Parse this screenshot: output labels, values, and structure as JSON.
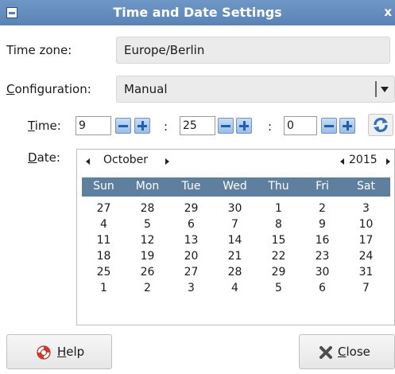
{
  "window": {
    "title": "Time and Date Settings",
    "close_glyph": "x",
    "colors": {
      "titlebar": "#5a83b5",
      "accent": "#5f7f9f",
      "spin_icon": "#1f5fb5"
    }
  },
  "timezone": {
    "label": "Time zone:",
    "value": "Europe/Berlin"
  },
  "configuration": {
    "label_first": "C",
    "label_rest": "onfiguration:",
    "value": "Manual",
    "icon": "chevron-down-icon"
  },
  "time": {
    "label_first": "T",
    "label_rest": "ime:",
    "hour": "9",
    "minute": "25",
    "second": "0",
    "separator": ":",
    "refresh_icon": "refresh-icon"
  },
  "date": {
    "label_first": "D",
    "label_rest": "ate:",
    "month": "October",
    "year": "2015",
    "weekdays": [
      "Sun",
      "Mon",
      "Tue",
      "Wed",
      "Thu",
      "Fri",
      "Sat"
    ],
    "weeks": [
      [
        "27",
        "28",
        "29",
        "30",
        "1",
        "2",
        "3"
      ],
      [
        "4",
        "5",
        "6",
        "7",
        "8",
        "9",
        "10"
      ],
      [
        "11",
        "12",
        "13",
        "14",
        "15",
        "16",
        "17"
      ],
      [
        "18",
        "19",
        "20",
        "21",
        "22",
        "23",
        "24"
      ],
      [
        "25",
        "26",
        "27",
        "28",
        "29",
        "30",
        "31"
      ],
      [
        "1",
        "2",
        "3",
        "4",
        "5",
        "6",
        "7"
      ]
    ]
  },
  "buttons": {
    "help": {
      "first": "H",
      "rest": "elp",
      "icon": "lifebuoy-icon"
    },
    "close": {
      "first": "C",
      "rest": "lose",
      "icon": "close-x-icon"
    }
  }
}
